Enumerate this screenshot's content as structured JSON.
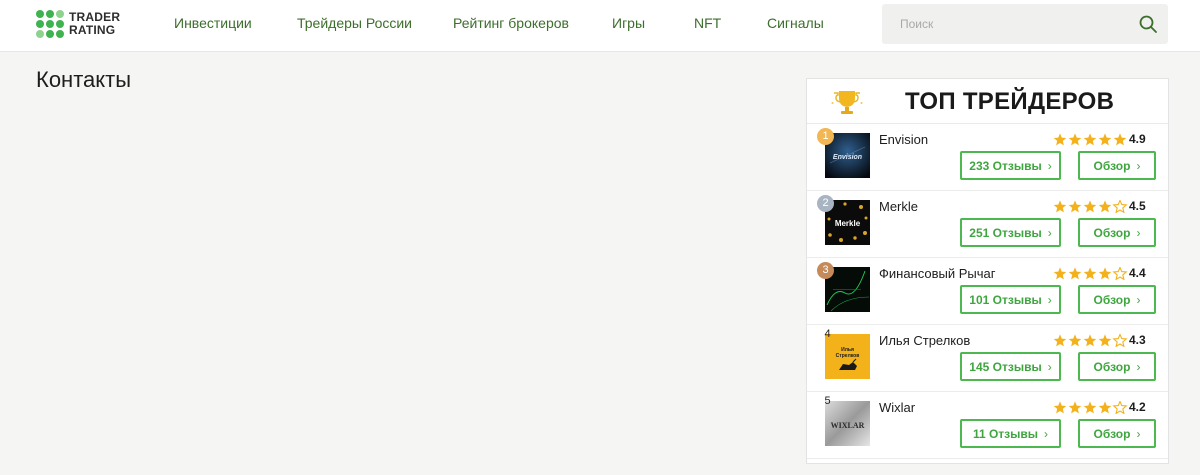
{
  "logo": {
    "line1": "TRADER",
    "line2": "RATING"
  },
  "nav": [
    {
      "label": "Инвестиции"
    },
    {
      "label": "Трейдеры России"
    },
    {
      "label": "Рейтинг брокеров"
    },
    {
      "label": "Игры"
    },
    {
      "label": "NFT"
    },
    {
      "label": "Сигналы"
    }
  ],
  "search": {
    "placeholder": "Поиск",
    "value": ""
  },
  "page": {
    "title": "Контакты"
  },
  "colors": {
    "accent": "#4cb84f",
    "nav": "#3c6e2c",
    "star": "#f3b21c",
    "gold": "#f2b652",
    "silver": "#a9b4c2",
    "bronze": "#c58a5a"
  },
  "widget": {
    "title": "ТОП ТРЕЙДЕРОВ",
    "traders": [
      {
        "rank": "1",
        "name": "Envision",
        "rating": "4.9",
        "stars": 5,
        "reviews": "233 Отзывы",
        "review_btn": "Обзор",
        "avatar_text": "Envision"
      },
      {
        "rank": "2",
        "name": "Merkle",
        "rating": "4.5",
        "stars": 4,
        "reviews": "251 Отзывы",
        "review_btn": "Обзор",
        "avatar_text": "Merkle"
      },
      {
        "rank": "3",
        "name": "Финансовый Рычаг",
        "rating": "4.4",
        "stars": 4,
        "reviews": "101 Отзывы",
        "review_btn": "Обзор",
        "avatar_text": ""
      },
      {
        "rank": "4",
        "name": "Илья Стрелков",
        "rating": "4.3",
        "stars": 4,
        "reviews": "145 Отзывы",
        "review_btn": "Обзор",
        "avatar_text": "Илья Стрелков"
      },
      {
        "rank": "5",
        "name": "Wixlar",
        "rating": "4.2",
        "stars": 4,
        "reviews": "11 Отзывы",
        "review_btn": "Обзор",
        "avatar_text": "WIXLAR"
      }
    ]
  }
}
